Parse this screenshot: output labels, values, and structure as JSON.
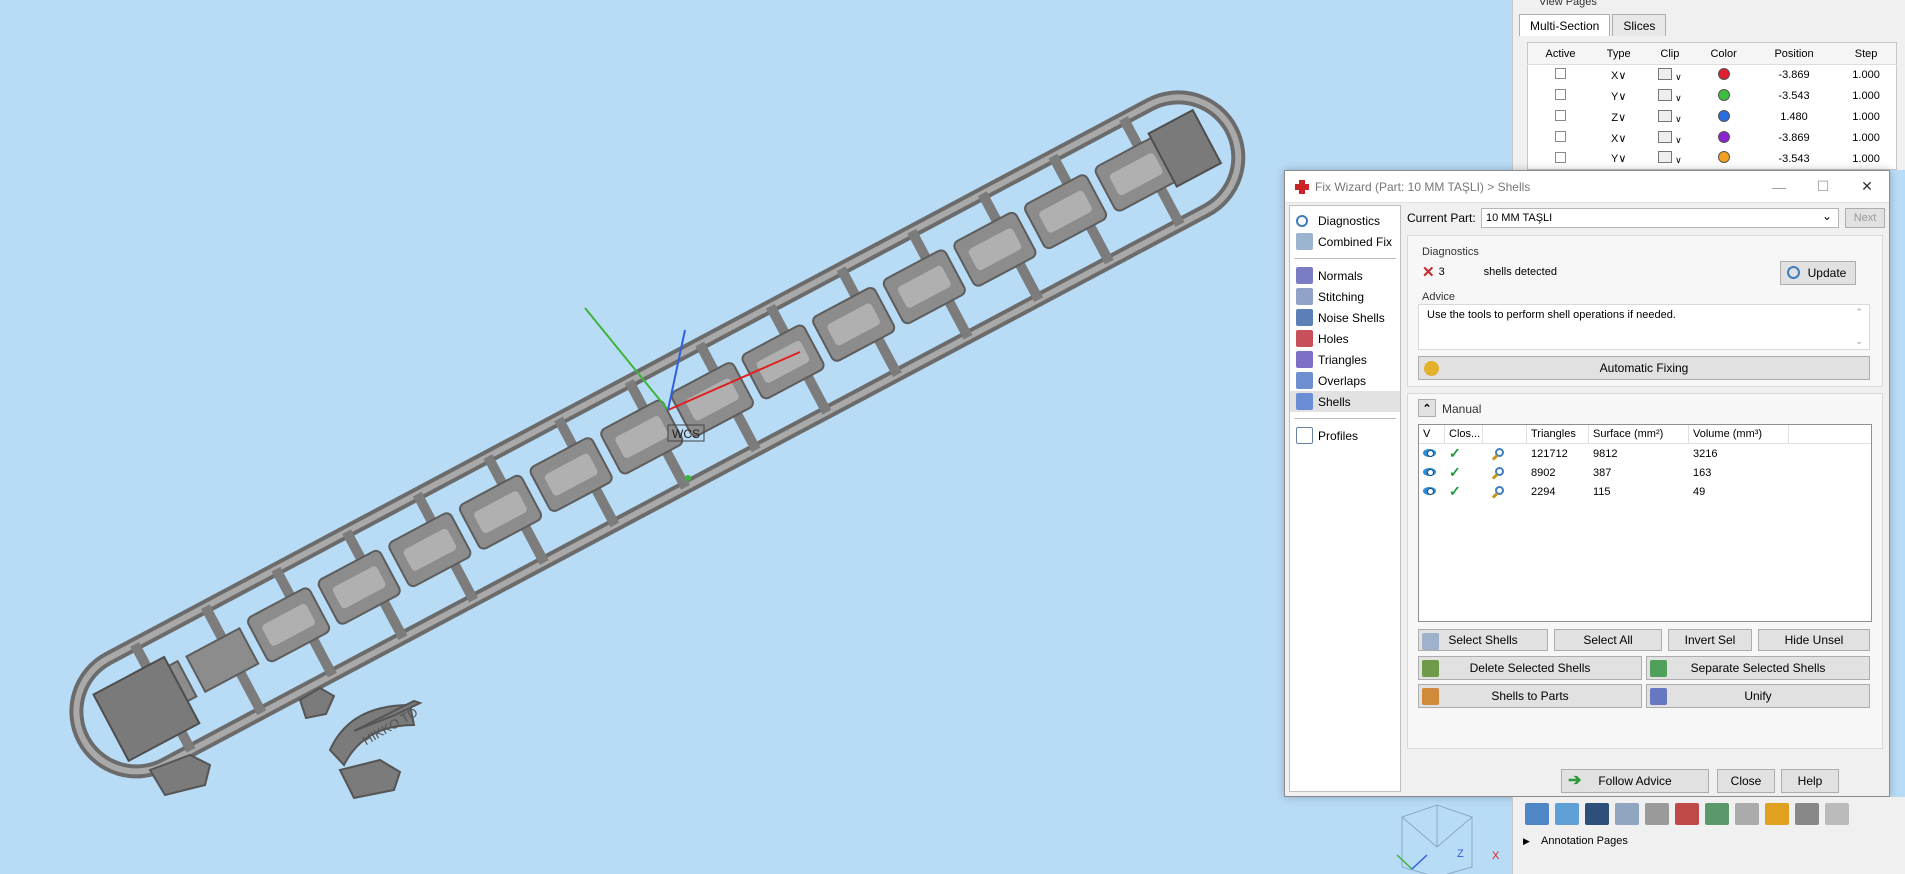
{
  "view_pages": {
    "title": "View Pages",
    "tabs": [
      "Multi-Section",
      "Slices"
    ],
    "columns": [
      "Active",
      "Type",
      "Clip",
      "Color",
      "Position",
      "Step"
    ],
    "rows": [
      {
        "type": "X∨",
        "color": "#e0202c",
        "position": "-3.869",
        "step": "1.000"
      },
      {
        "type": "Y∨",
        "color": "#3dbf3d",
        "position": "-3.543",
        "step": "1.000"
      },
      {
        "type": "Z∨",
        "color": "#2a6ee0",
        "position": "1.480",
        "step": "1.000"
      },
      {
        "type": "X∨",
        "color": "#8a22d0",
        "position": "-3.869",
        "step": "1.000"
      },
      {
        "type": "Y∨",
        "color": "#f3a020",
        "position": "-3.543",
        "step": "1.000"
      }
    ]
  },
  "wizard": {
    "title": "Fix Wizard (Part: 10 MM TAŞLI) > Shells",
    "minimize": "—",
    "maximize": "☐",
    "close_x": "✕",
    "nav_top": [
      {
        "label": "Diagnostics",
        "icon": "magnifier-icon"
      },
      {
        "label": "Combined Fix",
        "icon": "combined-fix-icon"
      }
    ],
    "nav_tools": [
      {
        "label": "Normals",
        "icon": "normals-icon"
      },
      {
        "label": "Stitching",
        "icon": "stitching-icon"
      },
      {
        "label": "Noise Shells",
        "icon": "noise-shells-icon"
      },
      {
        "label": "Holes",
        "icon": "holes-icon"
      },
      {
        "label": "Triangles",
        "icon": "triangles-icon"
      },
      {
        "label": "Overlaps",
        "icon": "overlaps-icon"
      },
      {
        "label": "Shells",
        "icon": "shells-icon"
      }
    ],
    "nav_bottom": [
      {
        "label": "Profiles",
        "icon": "profiles-icon"
      }
    ],
    "current_part_label": "Current Part:",
    "current_part_value": "10 MM TAŞLI",
    "next_label": "Next",
    "diagnostics": {
      "title": "Diagnostics",
      "count": "3",
      "text": "shells detected",
      "update_label": "Update"
    },
    "advice": {
      "title": "Advice",
      "text": "Use the tools to perform shell operations if needed."
    },
    "automatic_fixing_label": "Automatic Fixing",
    "manual": {
      "title": "Manual",
      "collapse_glyph": "⌃",
      "columns": [
        "V",
        "Clos...",
        "",
        "Triangles",
        "Surface (mm²)",
        "Volume (mm³)"
      ],
      "rows": [
        {
          "triangles": "121712",
          "surface": "9812",
          "volume": "3216"
        },
        {
          "triangles": "8902",
          "surface": "387",
          "volume": "163"
        },
        {
          "triangles": "2294",
          "surface": "115",
          "volume": "49"
        }
      ],
      "buttons": {
        "select_shells": "Select Shells",
        "select_all": "Select All",
        "invert_sel": "Invert Sel",
        "hide_unsel": "Hide Unsel",
        "delete_selected": "Delete Selected Shells",
        "separate_selected": "Separate Selected Shells",
        "shells_to_parts": "Shells to Parts",
        "unify": "Unify"
      }
    },
    "footer": {
      "follow_advice": "Follow Advice",
      "close": "Close",
      "help": "Help"
    }
  },
  "viewport": {
    "wcs_label": "WCS",
    "logo_text": "HIKKO TD"
  },
  "bottom_dock": {
    "annotation_title": "Annotation Pages"
  }
}
